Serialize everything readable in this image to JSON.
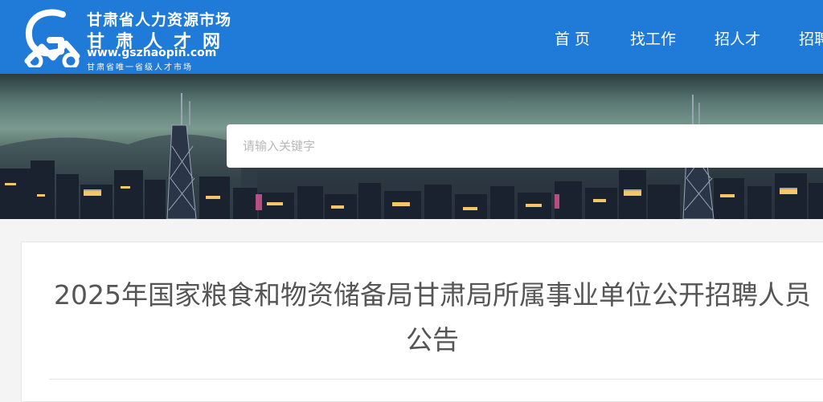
{
  "header": {
    "logo": {
      "line1": "甘肃省人力资源市场",
      "line2": "甘肃人才网",
      "line3": "www.gszhaopin.com",
      "line4": "甘肃省唯一省级人才市场"
    },
    "nav": [
      {
        "label": "首 页"
      },
      {
        "label": "找工作"
      },
      {
        "label": "招人才"
      },
      {
        "label": "招聘"
      }
    ]
  },
  "search": {
    "placeholder": "请输入关键字"
  },
  "article": {
    "title": "2025年国家粮食和物资储备局甘肃局所属事业单位公开招聘人员公告"
  },
  "colors": {
    "header_bg": "#1f7ad8",
    "page_bg": "#f4f4f4",
    "title_text": "#555555"
  }
}
